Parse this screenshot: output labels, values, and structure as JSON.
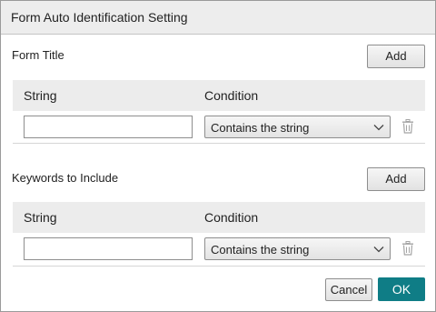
{
  "dialog": {
    "title": "Form Auto Identification Setting"
  },
  "sections": [
    {
      "label": "Form Title",
      "add_label": "Add",
      "columns": [
        "String",
        "Condition"
      ],
      "row": {
        "string_value": "",
        "condition": "Contains the string"
      }
    },
    {
      "label": "Keywords to Include",
      "add_label": "Add",
      "columns": [
        "String",
        "Condition"
      ],
      "row": {
        "string_value": "",
        "condition": "Contains the string"
      }
    }
  ],
  "footer": {
    "cancel_label": "Cancel",
    "ok_label": "OK"
  },
  "colors": {
    "ok_button": "#0f7d86",
    "header_bg": "#ececec",
    "titlebar_bg": "#ededed"
  },
  "icons": {
    "dropdown": "chevron-down-icon",
    "delete": "trash-icon"
  }
}
